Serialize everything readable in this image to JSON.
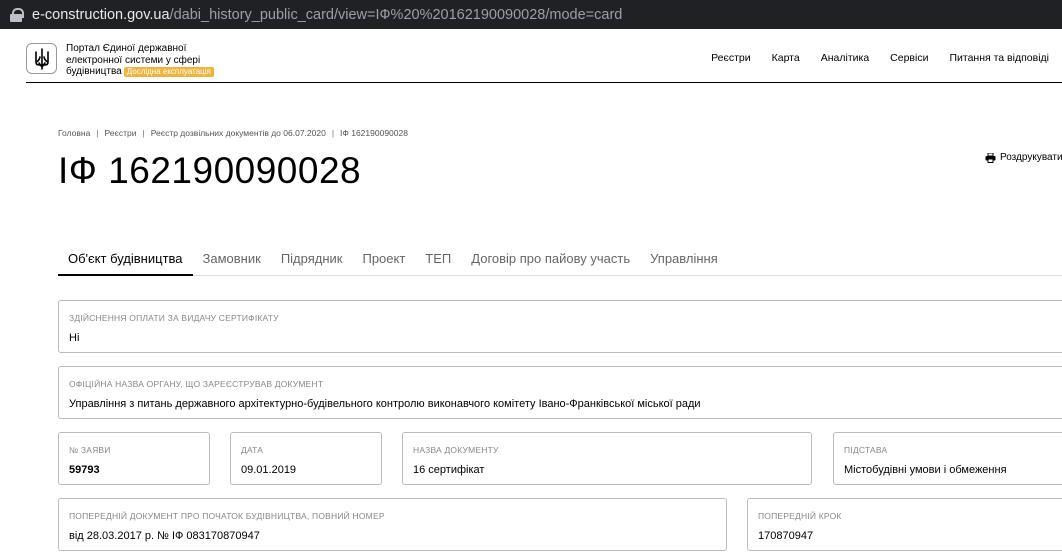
{
  "browser": {
    "url_host": "e-construction.gov.ua",
    "url_path": "/dabi_history_public_card/view=IФ%20%20162190090028/mode=card"
  },
  "header": {
    "logo_line1": "Портал Єдиної державної",
    "logo_line2": "електронної системи у сфері",
    "logo_line3": "будівництва",
    "badge": "Дослідна експлуатація",
    "nav": [
      "Реєстри",
      "Карта",
      "Аналітика",
      "Сервіси",
      "Питання та відповіді"
    ]
  },
  "breadcrumb": [
    "Головна",
    "Реєстри",
    "Реєстр дозвільних документів до 06.07.2020",
    "IФ 162190090028"
  ],
  "page": {
    "title": "IФ 162190090028",
    "download_label": "Роздрукувати"
  },
  "tabs": [
    "Об'єкт будівництва",
    "Замовник",
    "Підрядник",
    "Проект",
    "ТЕП",
    "Договір про пайову участь",
    "Управління"
  ],
  "fields": {
    "payment": {
      "label": "Здійснення оплати за видачу сертифікату",
      "value": "Ні"
    },
    "authority": {
      "label": "Офіційна назва органу, що зареєстрував документ",
      "value": "Управління з питань державного архітектурно-будівельного контролю виконавчого комітету Івано-Франківської міської ради"
    },
    "app_number": {
      "label": "№ заяви",
      "value": "59793"
    },
    "date": {
      "label": "Дата",
      "value": "09.01.2019"
    },
    "doc_name": {
      "label": "Назва документу",
      "value": "16 сертифікат"
    },
    "basis": {
      "label": "Підстава",
      "value": "Містобудівні умови і обмеження"
    },
    "prev_doc": {
      "label": "Попередній документ про початок будівництва, повний номер",
      "value": "від 28.03.2017 р. № IФ 083170870947"
    },
    "prev_step": {
      "label": "Попередній крок",
      "value": "170870947"
    }
  }
}
